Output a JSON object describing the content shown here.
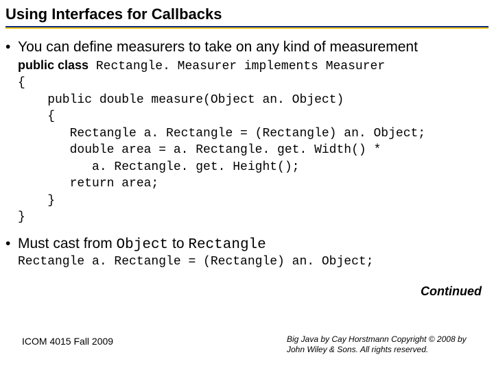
{
  "title": "Using Interfaces for Callbacks",
  "bullet1": "You can define measurers to take on any kind of measurement",
  "code": {
    "decl_prefix": "public class",
    "decl_rest": " Rectangle. Measurer implements Measurer",
    "l2": "{",
    "l3": "    public double measure(Object an. Object)",
    "l4": "    {",
    "l5": "       Rectangle a. Rectangle = (Rectangle) an. Object;",
    "l6": "       double area = a. Rectangle. get. Width() *",
    "l7": "          a. Rectangle. get. Height();",
    "l8": "       return area;",
    "l9": "    }",
    "l10": "}"
  },
  "bullet2": {
    "p1": "Must cast from ",
    "c1": "Object",
    "p2": " to ",
    "c2": "Rectangle"
  },
  "cast_line": "Rectangle a. Rectangle = (Rectangle) an. Object;",
  "continued": "Continued",
  "footer_left": "ICOM 4015 Fall 2009",
  "footer_right": "Big Java by Cay Horstmann Copyright © 2008 by John Wiley & Sons.  All rights reserved."
}
